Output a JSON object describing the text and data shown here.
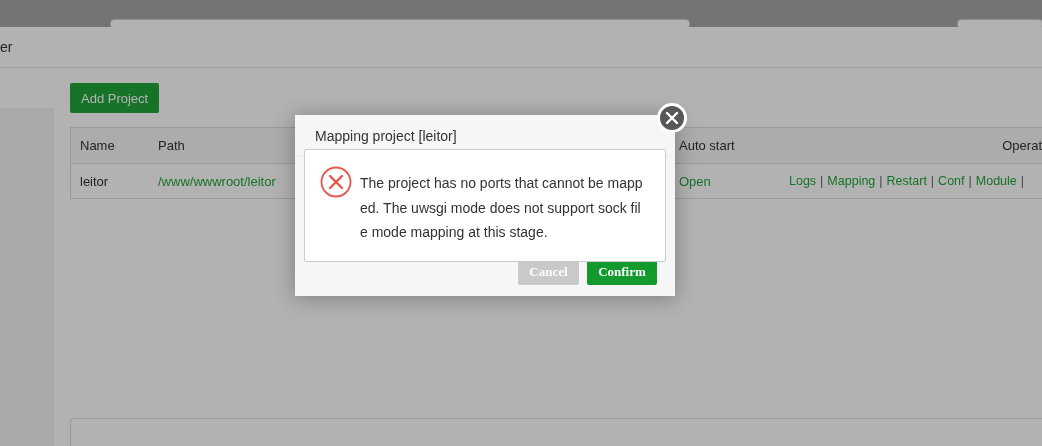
{
  "panel": {
    "title": "er"
  },
  "toolbar": {
    "add_button": "Add Project"
  },
  "table": {
    "columns": [
      "Name",
      "Path",
      "Auto start",
      "Operat"
    ],
    "rows": [
      {
        "name": "leitor",
        "path": "/www/wwwroot/leitor",
        "auto_start": "Open",
        "actions": [
          "Logs",
          "Mapping",
          "Restart",
          "Conf",
          "Module"
        ],
        "separator": "|"
      }
    ]
  },
  "dialog": {
    "title": "Mapping project [leitor]",
    "message_lines": [
      "The project has no ports that cannot be mapp",
      "ed. The uwsgi mode does not support sock fil",
      "e mode mapping at this stage."
    ],
    "buttons": [
      {
        "label": "Cancel",
        "kind": "secondary"
      },
      {
        "label": "Confirm",
        "kind": "primary"
      }
    ]
  }
}
